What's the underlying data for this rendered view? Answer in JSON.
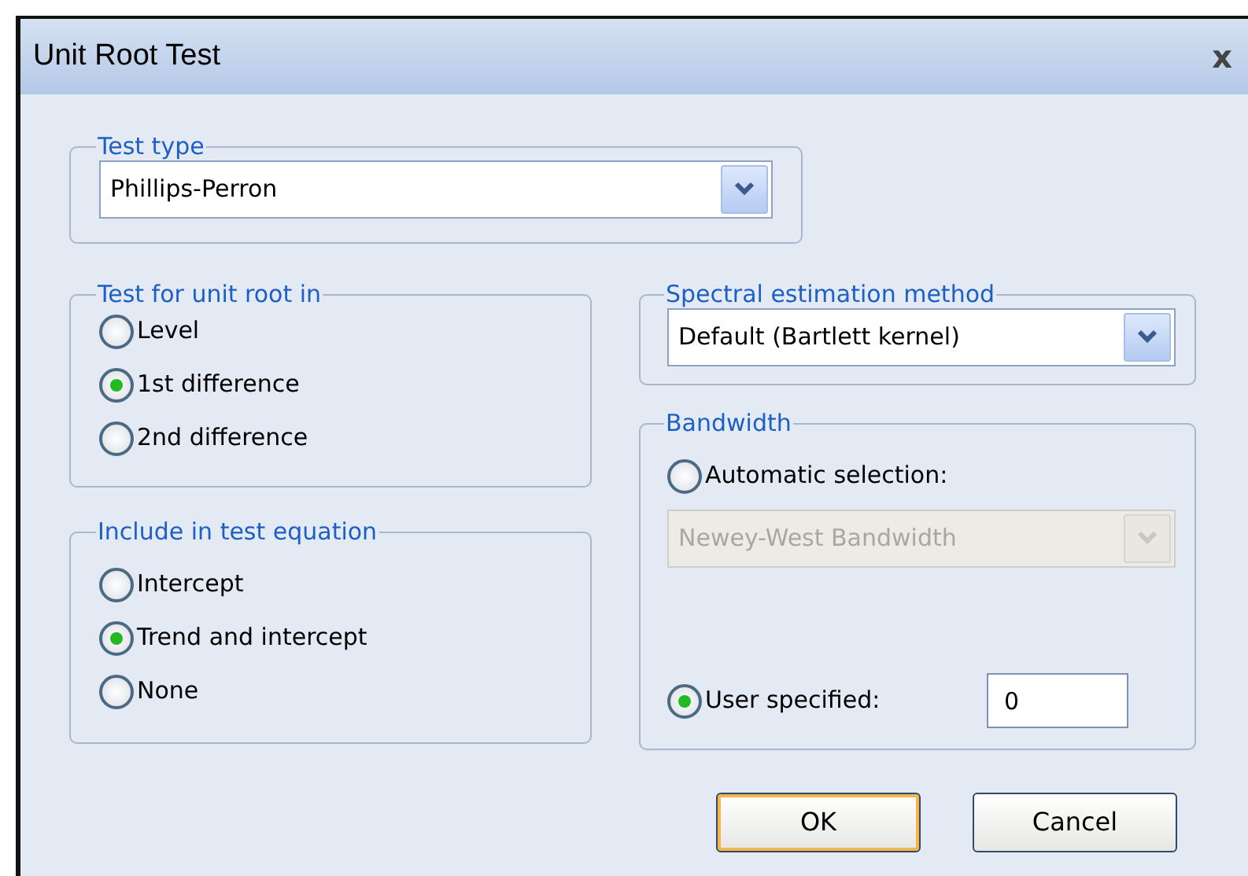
{
  "window": {
    "title": "Unit Root Test",
    "close": "x"
  },
  "test_type": {
    "legend": "Test type",
    "value": "Phillips-Perron"
  },
  "unit_root": {
    "legend": "Test for unit root in",
    "options": [
      {
        "label": "Level",
        "selected": false
      },
      {
        "label": "1st difference",
        "selected": true
      },
      {
        "label": "2nd difference",
        "selected": false
      }
    ]
  },
  "include": {
    "legend": "Include in test equation",
    "options": [
      {
        "label": "Intercept",
        "selected": false
      },
      {
        "label": "Trend and intercept",
        "selected": true
      },
      {
        "label": "None",
        "selected": false
      }
    ]
  },
  "spectral": {
    "legend": "Spectral estimation method",
    "value": "Default  (Bartlett kernel)"
  },
  "bandwidth": {
    "legend": "Bandwidth",
    "automatic": {
      "label": "Automatic selection:",
      "selected": false
    },
    "method": {
      "value": "Newey-West Bandwidth",
      "disabled": true
    },
    "user": {
      "label": "User specified:",
      "selected": true,
      "value": "0"
    }
  },
  "buttons": [
    {
      "label": "OK",
      "default": true
    },
    {
      "label": "Cancel",
      "default": false
    }
  ]
}
